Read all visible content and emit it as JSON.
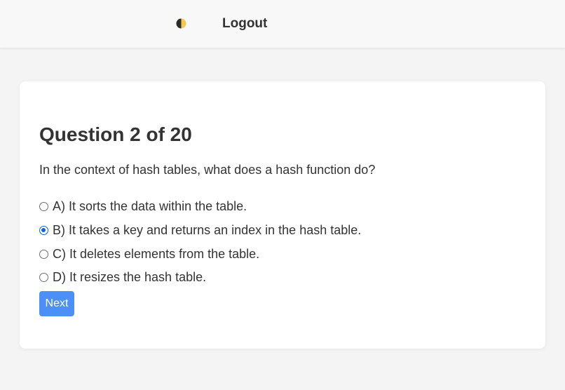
{
  "header": {
    "theme_icon": "half-moon-icon",
    "logout_label": "Logout"
  },
  "quiz": {
    "title": "Question 2 of 20",
    "question": "In the context of hash tables, what does a hash function do?",
    "options": [
      {
        "label": "A) It sorts the data within the table.",
        "selected": false
      },
      {
        "label": "B) It takes a key and returns an index in the hash table.",
        "selected": true
      },
      {
        "label": "C) It deletes elements from the table.",
        "selected": false
      },
      {
        "label": "D) It resizes the hash table.",
        "selected": false
      }
    ],
    "next_label": "Next"
  },
  "colors": {
    "accent": "#4c8ff7",
    "radio_selected": "#0a66d8",
    "theme_icon_dark": "#2b2b2b",
    "theme_icon_light": "#f2c94c"
  }
}
